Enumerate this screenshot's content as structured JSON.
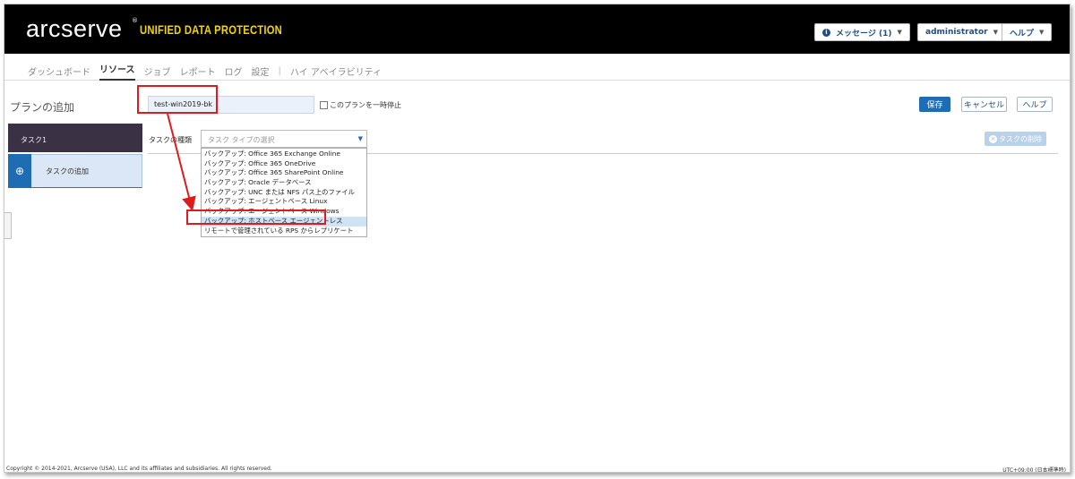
{
  "header": {
    "logo": "arcserve",
    "logo_mark": "®",
    "product": "UNIFIED DATA PROTECTION",
    "messages_label": "メッセージ (1)",
    "user_label": "administrator",
    "help_label": "ヘルプ"
  },
  "nav": {
    "items": [
      "ダッシュボード",
      "リソース",
      "ジョブ",
      "レポート",
      "ログ",
      "設定"
    ],
    "separator": "|",
    "ha_label": "ハイ アベイラビリティ",
    "active": "リソース"
  },
  "toolbar": {
    "page_title": "プランの追加",
    "plan_name_value": "test-win2019-bk",
    "pause_label": "このプランを一時停止",
    "save_label": "保存",
    "cancel_label": "キャンセル",
    "help_label": "ヘルプ"
  },
  "left_panel": {
    "task_label": "タスク1",
    "add_task_label": "タスクの追加"
  },
  "task_type": {
    "label": "タスクの種類",
    "placeholder": "タスク タイプの選択",
    "delete_label": "タスクの削除",
    "options": [
      "バックアップ: Office 365 Exchange Online",
      "バックアップ: Office 365 OneDrive",
      "バックアップ: Office 365 SharePoint Online",
      "バックアップ: Oracle データベース",
      "バックアップ: UNC または NFS パス上のファイル",
      "バックアップ: エージェントベース Linux",
      "バックアップ: エージェントベース Windows",
      "バックアップ: ホストベース エージェントレス",
      "リモートで管理されている RPS からレプリケート"
    ],
    "highlighted_index": 7
  },
  "footer": {
    "copyright": "Copyright © 2014-2021, Arcserve (USA), LLC and its affiliates and subsidiaries. All rights reserved.",
    "timezone": "UTC+09:00 (日本標準時)"
  },
  "colors": {
    "accent_blue": "#1d6cb4",
    "brand_yellow": "#f5d500",
    "annotation_red": "#e01b1b"
  }
}
